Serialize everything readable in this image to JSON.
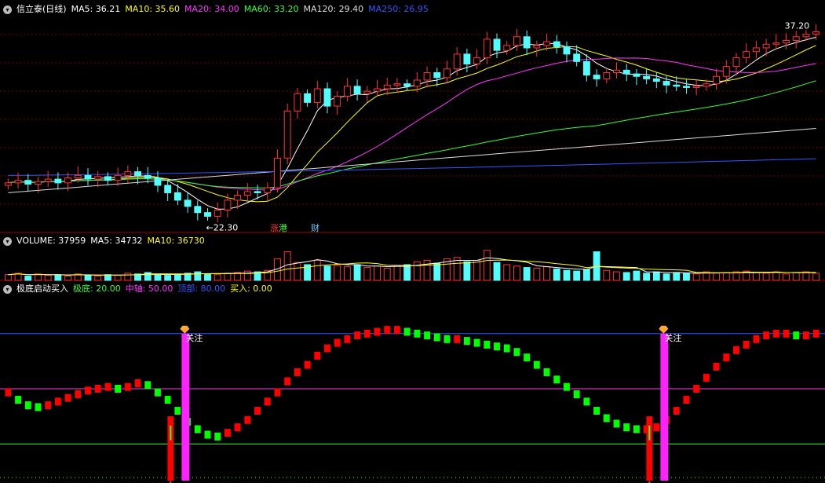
{
  "header": {
    "stock_name": "信立泰(日线)",
    "ma_labels": [
      {
        "text": "MA5: 36.21",
        "color": "#ffffff"
      },
      {
        "text": "MA10: 35.60",
        "color": "#ffff00"
      },
      {
        "text": "MA20: 34.00",
        "color": "#ff33ff"
      },
      {
        "text": "MA60: 33.20",
        "color": "#33ff33"
      },
      {
        "text": "MA120: 29.40",
        "color": "#dddddd"
      },
      {
        "text": "MA250: 26.95",
        "color": "#3355ff"
      }
    ]
  },
  "price_panel": {
    "high_annotation": "37.20",
    "low_annotation": "22.30",
    "markers": [
      {
        "text": "涨",
        "color": "#ff3333"
      },
      {
        "text": "港",
        "color": "#33ff33"
      },
      {
        "text": "财",
        "color": "#66ccff"
      }
    ]
  },
  "volume_panel": {
    "labels": [
      {
        "text": "VOLUME: 37959",
        "color": "#ffffff"
      },
      {
        "text": "MA5: 34732",
        "color": "#ffffff"
      },
      {
        "text": "MA10: 36730",
        "color": "#ffff00"
      }
    ]
  },
  "indicator_panel": {
    "labels": [
      {
        "text": "极底启动买入",
        "color": "#ffffff"
      },
      {
        "text": "极底: 20.00",
        "color": "#33ff33"
      },
      {
        "text": "中轴: 50.00",
        "color": "#ff33ff"
      },
      {
        "text": "顶部: 80.00",
        "color": "#3355ff"
      },
      {
        "text": "买入: 0.00",
        "color": "#ffff00"
      }
    ],
    "attention_label": "关注"
  },
  "chart_data": [
    {
      "type": "candlestick",
      "name": "price",
      "high_label": 37.2,
      "low_label": 22.3,
      "closes": [
        25.0,
        25.2,
        24.9,
        25.1,
        25.3,
        25.0,
        25.4,
        25.6,
        25.3,
        25.5,
        25.2,
        25.6,
        25.9,
        25.6,
        25.4,
        24.8,
        24.2,
        23.6,
        23.1,
        22.6,
        22.3,
        22.8,
        23.6,
        24.0,
        24.3,
        24.2,
        24.6,
        27.0,
        30.8,
        32.2,
        31.5,
        32.6,
        31.2,
        32.0,
        32.8,
        32.2,
        32.4,
        32.6,
        32.9,
        33.0,
        32.8,
        33.3,
        33.9,
        33.5,
        34.2,
        35.4,
        34.6,
        35.1,
        36.6,
        35.7,
        36.1,
        36.8,
        35.9,
        36.1,
        36.4,
        36.0,
        35.4,
        34.8,
        33.7,
        33.4,
        33.9,
        34.1,
        33.8,
        33.6,
        33.4,
        33.2,
        32.9,
        32.8,
        32.7,
        32.8,
        33.0,
        33.6,
        34.4,
        35.1,
        35.6,
        35.9,
        36.2,
        36.3,
        36.5,
        36.8,
        37.0,
        37.2
      ]
    },
    {
      "type": "bar",
      "name": "volume",
      "values": [
        8,
        10,
        6,
        9,
        7,
        8,
        6,
        9,
        7,
        6,
        8,
        7,
        10,
        9,
        11,
        8,
        7,
        9,
        10,
        12,
        9,
        8,
        10,
        11,
        13,
        12,
        14,
        30,
        40,
        25,
        22,
        28,
        20,
        21,
        19,
        22,
        18,
        20,
        17,
        21,
        22,
        26,
        28,
        24,
        30,
        32,
        26,
        28,
        42,
        25,
        22,
        20,
        18,
        17,
        19,
        16,
        14,
        13,
        15,
        40,
        14,
        12,
        11,
        13,
        10,
        12,
        9,
        11,
        10,
        9,
        12,
        10,
        11,
        12,
        13,
        11,
        10,
        12,
        9,
        11,
        12,
        10
      ]
    },
    {
      "type": "bar",
      "name": "极底启动买入",
      "levels": {
        "极底": 20,
        "中轴": 50,
        "顶部": 80,
        "买入": 0
      },
      "values": [
        48,
        44,
        41,
        40,
        41,
        43,
        45,
        47,
        49,
        50,
        51,
        50,
        51,
        53,
        52,
        48,
        44,
        38,
        32,
        28,
        25,
        24,
        26,
        29,
        33,
        38,
        43,
        48,
        54,
        59,
        63,
        68,
        72,
        75,
        77,
        79,
        80,
        81,
        82,
        82,
        81,
        80,
        79,
        78,
        77,
        77,
        76,
        75,
        74,
        73,
        72,
        70,
        67,
        63,
        59,
        55,
        51,
        47,
        43,
        38,
        34,
        31,
        29,
        28,
        28,
        29,
        33,
        38,
        44,
        50,
        56,
        62,
        67,
        71,
        74,
        77,
        79,
        80,
        80,
        79,
        79,
        80
      ],
      "signals": [
        {
          "index": 17,
          "label": "关注"
        },
        {
          "index": 65,
          "label": "关注"
        }
      ]
    }
  ]
}
